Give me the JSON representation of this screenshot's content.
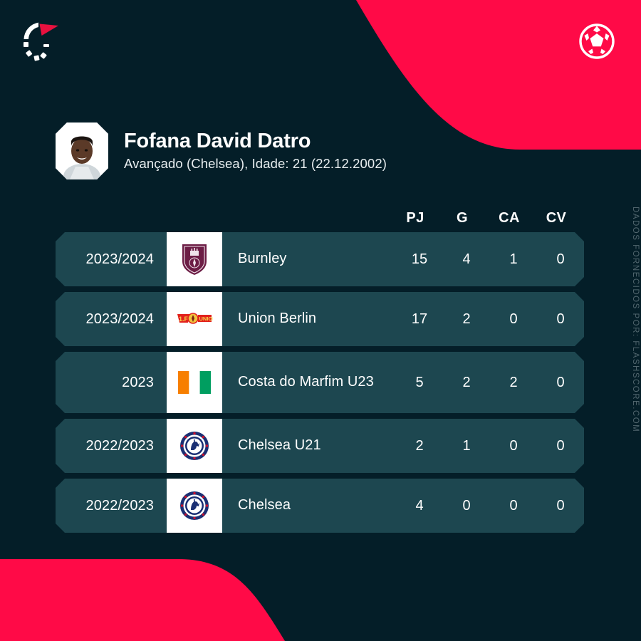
{
  "brand": {
    "logo_name": "flashscore-logo",
    "ball_icon_name": "soccer-ball-icon",
    "accent_color": "#ff0a47",
    "background_color": "#041e28",
    "row_color": "#1d4750"
  },
  "player": {
    "name": "Fofana David Datro",
    "meta": "Avançado (Chelsea), Idade: 21 (22.12.2002)",
    "photo_name": "player-photo"
  },
  "table": {
    "columns": [
      "PJ",
      "G",
      "CA",
      "CV"
    ],
    "rows": [
      {
        "season": "2023/2024",
        "team": "Burnley",
        "crest": "burnley-crest",
        "pj": "15",
        "g": "4",
        "ca": "1",
        "cv": "0"
      },
      {
        "season": "2023/2024",
        "team": "Union Berlin",
        "crest": "union-berlin-crest",
        "pj": "17",
        "g": "2",
        "ca": "0",
        "cv": "0"
      },
      {
        "season": "2023",
        "team": "Costa do Marfim U23",
        "crest": "ivory-coast-flag",
        "pj": "5",
        "g": "2",
        "ca": "2",
        "cv": "0"
      },
      {
        "season": "2022/2023",
        "team": "Chelsea U21",
        "crest": "chelsea-crest",
        "pj": "2",
        "g": "1",
        "ca": "0",
        "cv": "0"
      },
      {
        "season": "2022/2023",
        "team": "Chelsea",
        "crest": "chelsea-crest",
        "pj": "4",
        "g": "0",
        "ca": "0",
        "cv": "0"
      }
    ]
  },
  "credit": "DADOS FORNECIDOS POR: FLASHSCORE.COM"
}
